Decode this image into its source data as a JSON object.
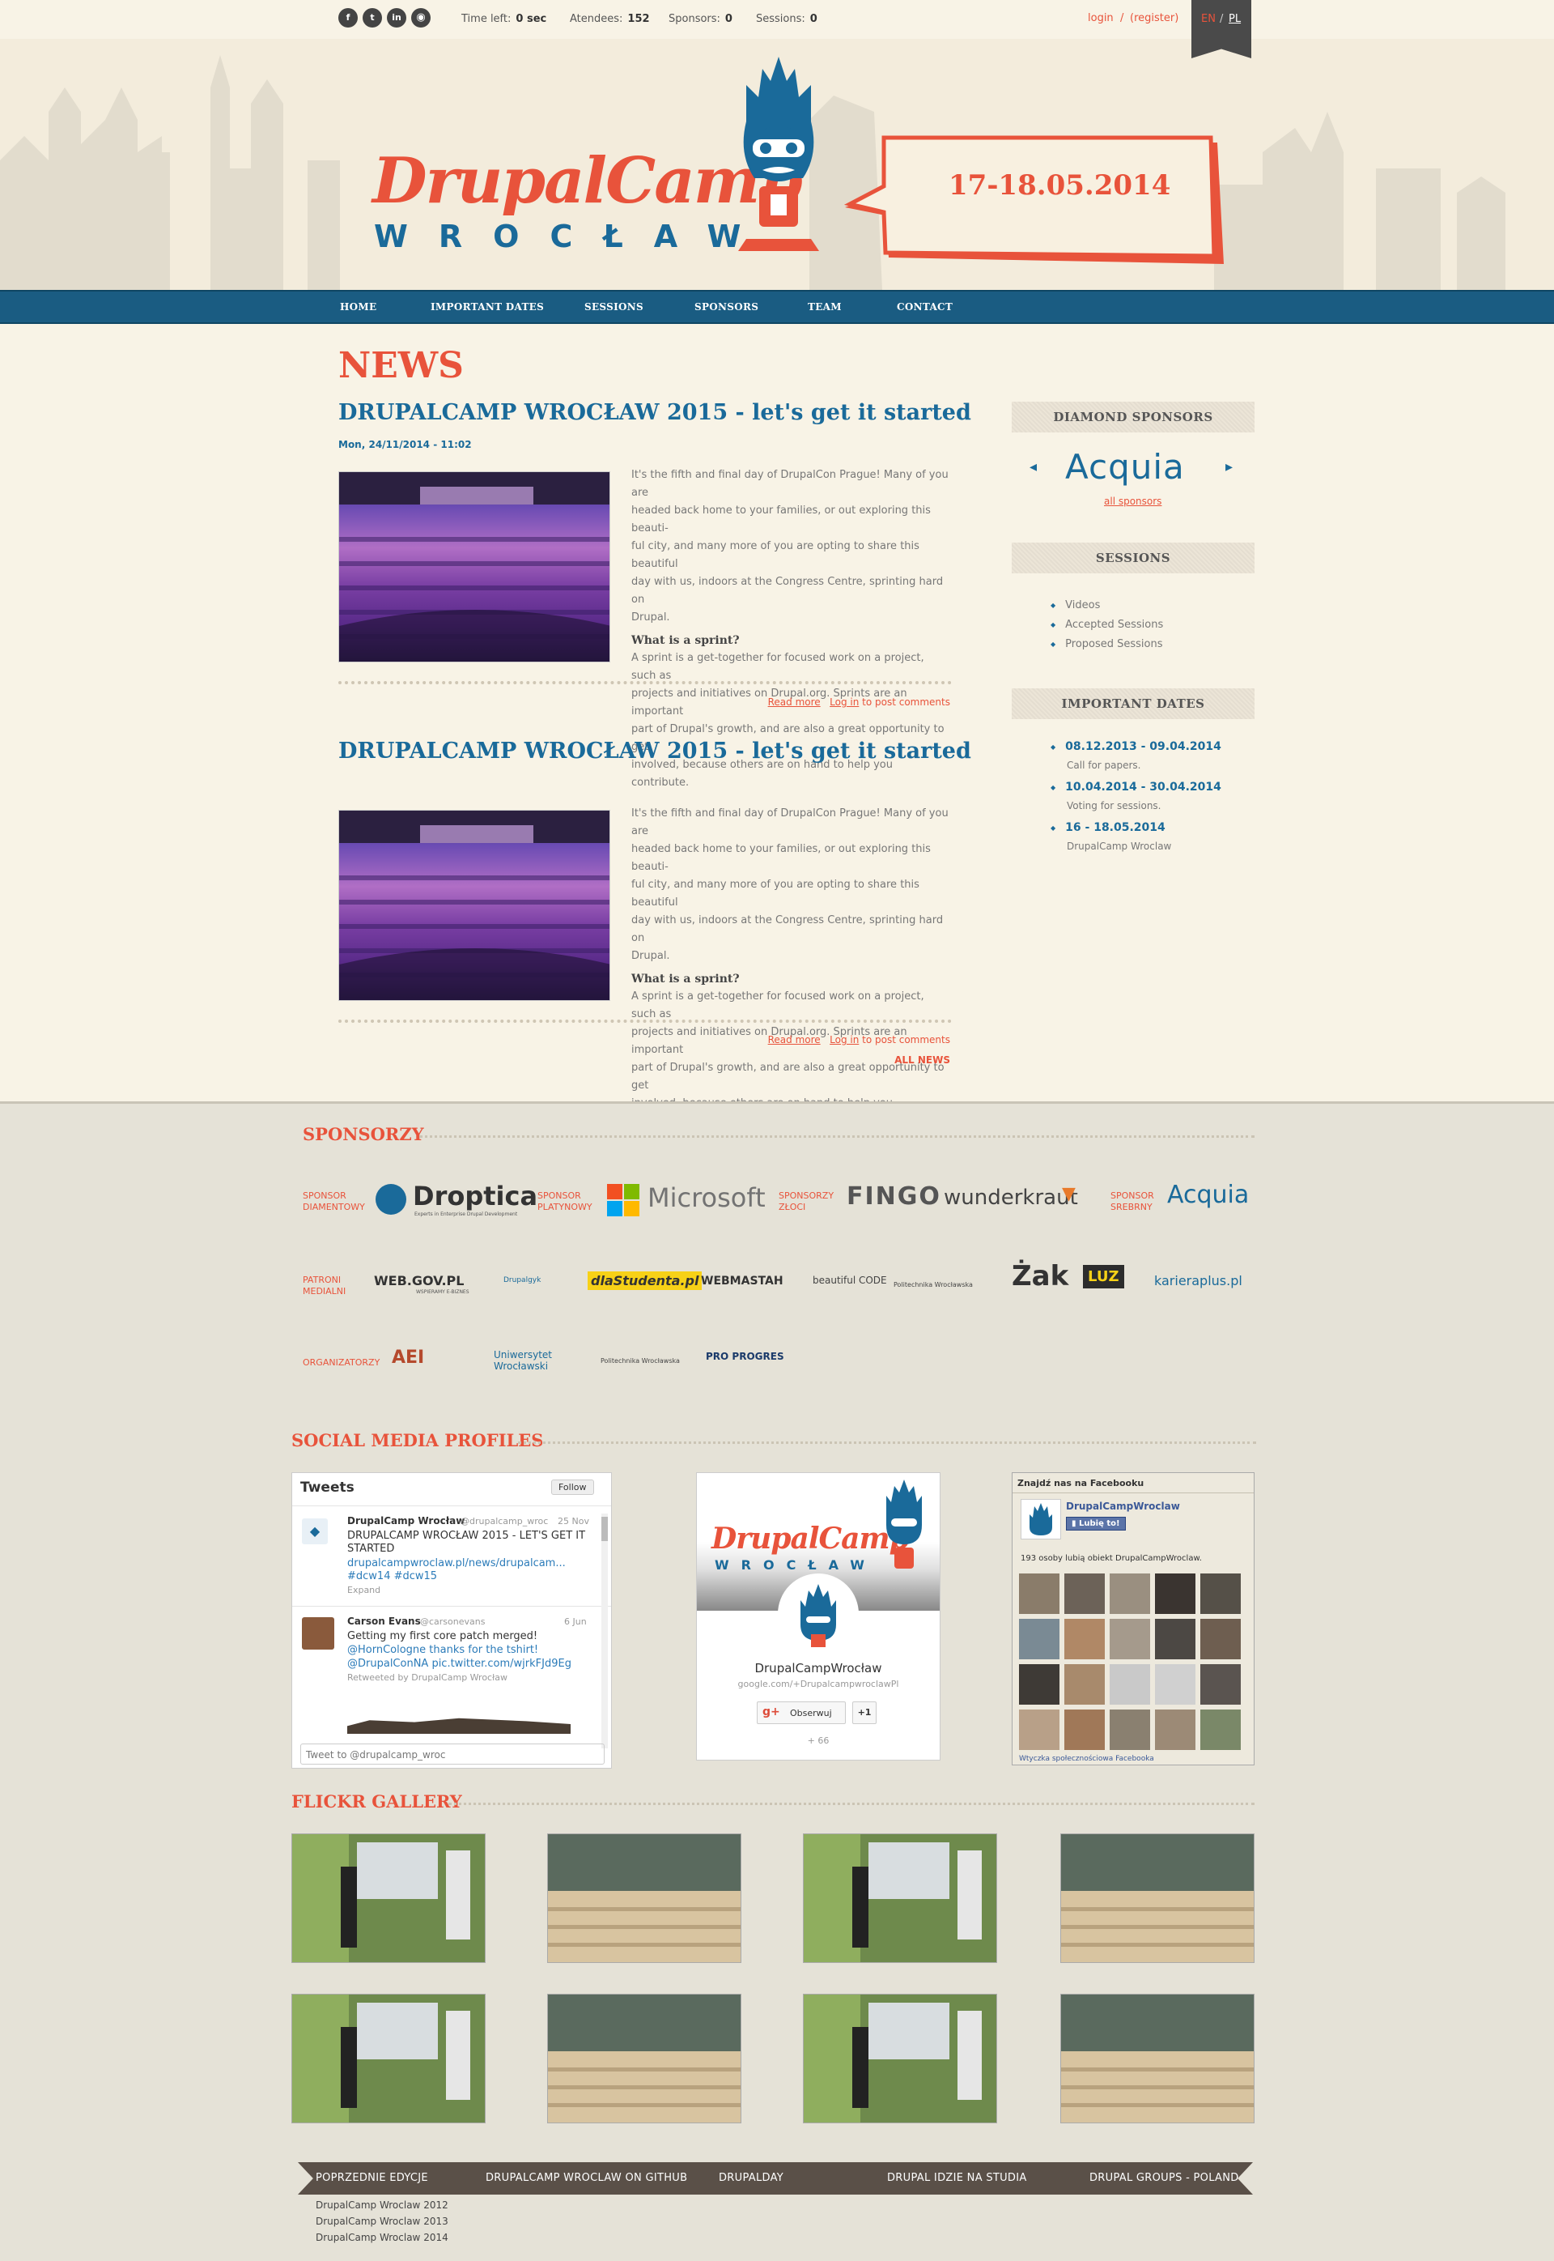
{
  "topbar": {
    "social": [
      "facebook-icon",
      "twitter-icon",
      "linkedin-icon",
      "rss-icon"
    ],
    "time_left_label": "Time left:",
    "time_left_value": "0 sec",
    "attendees_label": "Atendees:",
    "attendees_value": "152",
    "sponsors_label": "Sponsors:",
    "sponsors_value": "0",
    "sessions_label": "Sessions:",
    "sessions_value": "0",
    "login": "login",
    "slash": "/",
    "register": "(register)",
    "lang_en": "EN",
    "lang_sep": "/",
    "lang_pl": "PL"
  },
  "header": {
    "logo_title": "DrupalCamp",
    "logo_sub": "WROCŁAW",
    "date_badge": "17-18.05.2014"
  },
  "nav": [
    "HOME",
    "IMPORTANT DATES",
    "SESSIONS",
    "SPONSORS",
    "TEAM",
    "CONTACT"
  ],
  "main": {
    "section_title": "NEWS",
    "articles": [
      {
        "title": "DRUPALCAMP WROCŁAW 2015 - let's get it started",
        "date": "Mon, 24/11/2014 - 11:02",
        "lead_lines": [
          "It's the fifth and final day of DrupalCon Prague! Many of you are",
          "headed back home to your families, or out exploring this beauti-",
          "ful city, and many more of you are opting to share this beautiful",
          "day with us, indoors at the Congress Centre, sprinting hard on",
          "Drupal."
        ],
        "subhead": "What is a sprint?",
        "body_lines": [
          "A sprint is a get-together for focused work on a project, such as",
          "projects and initiatives on Drupal.org. Sprints are an important",
          "part of Drupal's growth, and are also a great opportunity to get",
          "involved, because others are on hand to help you contribute."
        ],
        "read_more": "Read more",
        "login": "Log in",
        "post_comments": "to post comments"
      },
      {
        "title": "DRUPALCAMP WROCŁAW 2015 - let's get it started",
        "date": "",
        "lead_lines": [
          "It's the fifth and final day of DrupalCon Prague! Many of you are",
          "headed back home to your families, or out exploring this beauti-",
          "ful city, and many more of you are opting to share this beautiful",
          "day with us, indoors at the Congress Centre, sprinting hard on",
          "Drupal."
        ],
        "subhead": "What is a sprint?",
        "body_lines": [
          "A sprint is a get-together for focused work on a project, such as",
          "projects and initiatives on Drupal.org. Sprints are an important",
          "part of Drupal's growth, and are also a great opportunity to get",
          "involved, because others are on hand to help you contribute."
        ],
        "read_more": "Read more",
        "login": "Log in",
        "post_comments": "to post comments"
      }
    ],
    "all_news": "ALL NEWS"
  },
  "sidebar": {
    "diamond_title": "DIAMOND SPONSORS",
    "diamond_logo": "Acquia",
    "all_sponsors": "all sponsors",
    "sessions_title": "SESSIONS",
    "sessions_items": [
      "Videos",
      "Accepted Sessions",
      "Proposed Sessions"
    ],
    "dates_title": "IMPORTANT DATES",
    "dates": [
      {
        "date": "08.12.2013 - 09.04.2014",
        "note": "Call for papers."
      },
      {
        "date": "10.04.2014 - 30.04.2014",
        "note": "Voting for sessions."
      },
      {
        "date": "16 - 18.05.2014",
        "note": "DrupalCamp Wroclaw"
      }
    ]
  },
  "sponsors": {
    "title": "SPONSORZY",
    "diamond_label": [
      "SPONSOR",
      "DIAMENTOWY"
    ],
    "diamond_logo": "Droptica",
    "diamond_tag": "Experts in Enterprise Drupal Development",
    "platinum_label": [
      "SPONSOR",
      "PLATYNOWY"
    ],
    "platinum_logo": "Microsoft",
    "gold_label": [
      "SPONSORZY",
      "ZŁOCI"
    ],
    "gold_logos": [
      "FINGO",
      "wunderkraut"
    ],
    "silver_label": [
      "SPONSOR",
      "SREBRNY"
    ],
    "silver_logo": "Acquia",
    "media_label": [
      "PATRONI",
      "MEDIALNI"
    ],
    "media_logos": [
      "WEB.GOV.PL",
      "Drupalgyk",
      "dlaStudenta.pl",
      "WEBMASTAH",
      "beautiful CODE",
      "Politechnika Wrocławska",
      "Żak",
      "LUZ",
      "karieraplus.pl"
    ],
    "web_gov_tag": "WSPIERAMY E-BIZNES",
    "org_label": [
      "ORGANIZATORZY"
    ],
    "org_logos": [
      "AEI",
      "Uniwersytet Wrocławski",
      "Politechnika Wrocławska",
      "PRO PROGRES"
    ]
  },
  "social": {
    "title": "SOCIAL MEDIA PROFILES",
    "twitter": {
      "header": "Tweets",
      "follow": "Follow",
      "tweets": [
        {
          "name": "DrupalCamp Wrocław",
          "handle": "@drupalcamp_wroc",
          "date": "25 Nov",
          "text": "DRUPALCAMP WROCŁAW 2015 - LET'S GET IT STARTED",
          "link": "drupalcampwroclaw.pl/news/drupalcam...",
          "tags": "#dcw14 #dcw15",
          "extra": "Expand"
        },
        {
          "name": "Carson Evans",
          "handle": "@carsonevans",
          "date": "6 Jun",
          "text": "Getting my first core patch merged!",
          "link": "@HornCologne thanks for the tshirt!",
          "tags": "@DrupalConNA pic.twitter.com/wjrkFJd9Eg",
          "extra": "Retweeted by DrupalCamp Wrocław"
        }
      ],
      "compose_placeholder": "Tweet to @drupalcamp_wroc"
    },
    "gplus": {
      "name": "DrupalCampWrocław",
      "url": "google.com/+DrupalcampwroclawPl",
      "follow": "Obserwuj",
      "plusone": "+1",
      "count": "+ 66"
    },
    "facebook": {
      "header": "Znajdź nas na Facebooku",
      "page_name": "DrupalCampWroclaw",
      "like": "Lubię to!",
      "likes_text": "193 osoby lubią obiekt DrupalCampWroclaw.",
      "footer": "Wtyczka społecznościowa Facebooka"
    }
  },
  "flickr": {
    "title": "FLICKR GALLERY",
    "count": 8
  },
  "footer": {
    "menu": [
      "POPRZEDNIE EDYCJE",
      "DRUPALCAMP WROCLAW ON GITHUB",
      "DRUPALDAY",
      "DRUPAL IDZIE NA STUDIA",
      "DRUPAL GROUPS - POLAND"
    ],
    "links": [
      "DrupalCamp Wroclaw 2012",
      "DrupalCamp Wroclaw 2013",
      "DrupalCamp Wroclaw 2014"
    ]
  },
  "colors": {
    "accent": "#e8533b",
    "brand_blue": "#1a6a9a",
    "nav": "#1a5c82"
  }
}
